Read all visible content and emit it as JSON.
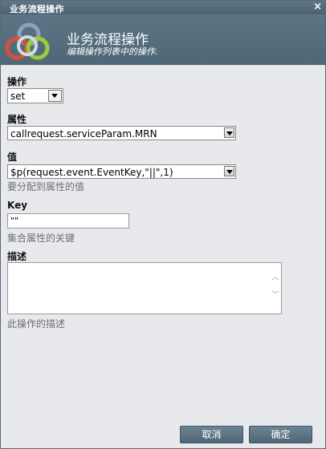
{
  "window": {
    "title": "业务流程操作",
    "close_glyph": "×"
  },
  "header": {
    "title": "业务流程操作",
    "subtitle": "编辑操作列表中的操作."
  },
  "form": {
    "operation": {
      "label": "操作",
      "value": "set"
    },
    "property": {
      "label": "属性",
      "value": "callrequest.serviceParam.MRN"
    },
    "value": {
      "label": "值",
      "value": "$p(request.event.EventKey,\"||\",1)",
      "help": "要分配到属性的值"
    },
    "key": {
      "label": "Key",
      "value": "\"\"",
      "help": "集合属性的关键"
    },
    "description": {
      "label": "描述",
      "value": "",
      "help": "此操作的描述"
    }
  },
  "footer": {
    "cancel_label": "取消",
    "ok_label": "确定"
  },
  "colors": {
    "titlebar": "#4f6878",
    "panel": "#e7e9ec",
    "button": "#5a7282"
  }
}
